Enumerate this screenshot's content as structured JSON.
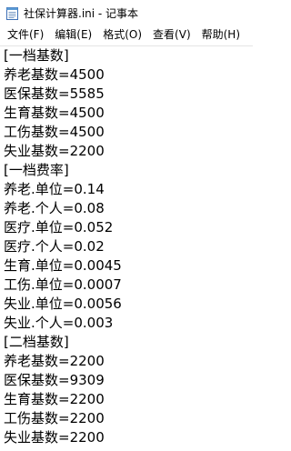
{
  "titlebar": {
    "title": "社保计算器.ini - 记事本",
    "icon": "notepad-icon"
  },
  "menu": {
    "items": [
      {
        "label": "文件(F)"
      },
      {
        "label": "编辑(E)"
      },
      {
        "label": "格式(O)"
      },
      {
        "label": "查看(V)"
      },
      {
        "label": "帮助(H)"
      }
    ]
  },
  "editor": {
    "lines": [
      "[一档基数]",
      "养老基数=4500",
      "医保基数=5585",
      "生育基数=4500",
      "工伤基数=4500",
      "失业基数=2200",
      "[一档费率]",
      "养老.单位=0.14",
      "养老.个人=0.08",
      "医疗.单位=0.052",
      "医疗.个人=0.02",
      "生育.单位=0.0045",
      "工伤.单位=0.0007",
      "失业.单位=0.0056",
      "失业.个人=0.003",
      "[二档基数]",
      "养老基数=2200",
      "医保基数=9309",
      "生育基数=2200",
      "工伤基数=2200",
      "失业基数=2200"
    ]
  }
}
